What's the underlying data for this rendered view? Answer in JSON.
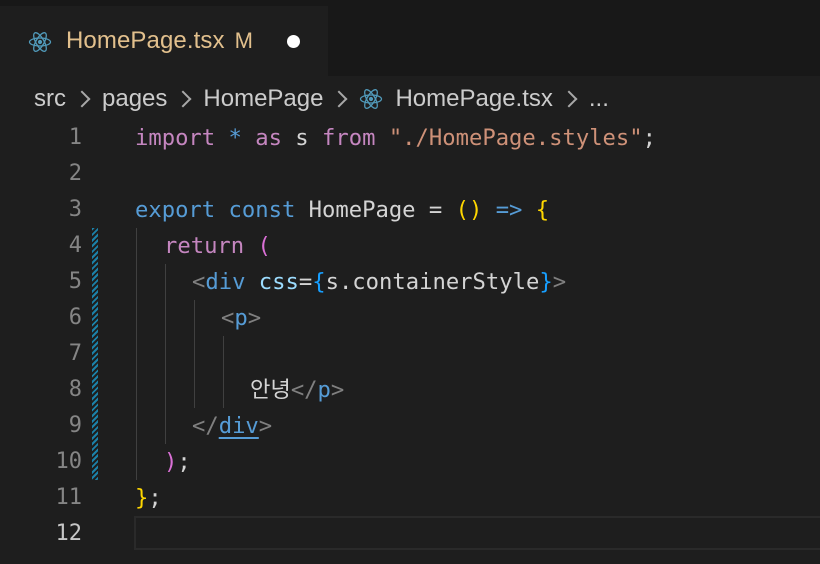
{
  "tab": {
    "title": "HomePage.tsx",
    "modified_letter": "M",
    "icon": "react-icon"
  },
  "breadcrumb": {
    "items": [
      "src",
      "pages",
      "HomePage",
      "HomePage.tsx",
      "..."
    ]
  },
  "editor": {
    "line_numbers": [
      "1",
      "2",
      "3",
      "4",
      "5",
      "6",
      "7",
      "8",
      "9",
      "10",
      "11",
      "12"
    ],
    "active_line": "12",
    "lines": {
      "l1": {
        "import": "import",
        "star": " * ",
        "as": "as",
        "s": " s ",
        "from": "from",
        "path": " \"./HomePage.styles\"",
        "semi": ";"
      },
      "l3": {
        "export": "export",
        "const": " const ",
        "name": "HomePage",
        "eq": " = ",
        "parens": "()",
        "arrow": " => ",
        "brace": "{"
      },
      "l4": {
        "return": "return",
        "paren": " ("
      },
      "l5": {
        "open": "<",
        "tag": "div",
        "attr": " css",
        "eq": "=",
        "lbrace": "{",
        "expr": "s.containerStyle",
        "rbrace": "}",
        "close": ">"
      },
      "l6": {
        "open": "<",
        "tag": "p",
        "close": ">"
      },
      "l8": {
        "text": "안녕",
        "open": "</",
        "tag": "p",
        "close": ">"
      },
      "l9": {
        "open": "</",
        "tag": "div",
        "close": ">"
      },
      "l10": {
        "paren": ")",
        "semi": ";"
      },
      "l11": {
        "brace": "}",
        "semi": ";"
      }
    }
  },
  "colors": {
    "background": "#1e1e1e",
    "tab_bar": "#181818",
    "modified_file": "#e2c08d",
    "keyword": "#569cd6",
    "control_keyword": "#c586c0",
    "string": "#ce9178",
    "variable": "#9cdcfe",
    "bracket_gold": "#ffd700",
    "bracket_orchid": "#da70d6",
    "bracket_blue": "#179fff",
    "react_icon": "#519aba"
  }
}
